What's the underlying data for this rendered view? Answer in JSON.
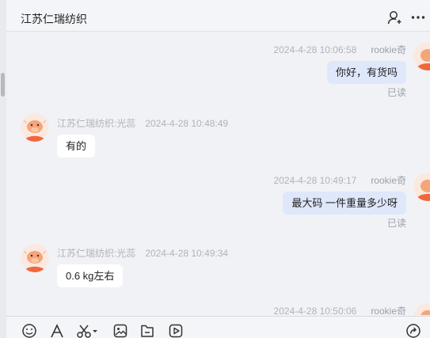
{
  "header": {
    "title": "江苏仁瑞纺织",
    "icons": [
      "add-contact-icon",
      "more-icon"
    ]
  },
  "messages": [
    {
      "direction": "out",
      "sender": "rookie奇",
      "time": "2024-4-28 10:06:58",
      "text": "你好，有货吗",
      "status": "已读"
    },
    {
      "direction": "in",
      "sender": "江苏仁瑞纺织:光蕊",
      "time": "2024-4-28 10:48:49",
      "text": "有的"
    },
    {
      "direction": "out",
      "sender": "rookie奇",
      "time": "2024-4-28 10:49:17",
      "text": "最大码 一件重量多少呀",
      "status": "已读"
    },
    {
      "direction": "in",
      "sender": "江苏仁瑞纺织:光蕊",
      "time": "2024-4-28 10:49:34",
      "text": "0.6 kg左右"
    },
    {
      "direction": "out",
      "sender": "rookie奇",
      "time": "2024-4-28 10:50:06",
      "text": ""
    }
  ],
  "toolbar": {
    "icons": [
      "emoji-icon",
      "font-icon",
      "screenshot-icon",
      "image-icon",
      "file-icon",
      "video-icon",
      "share-icon"
    ]
  },
  "colors": {
    "background": "#f1f2f6",
    "outgoing_bubble": "#dfe7fb",
    "incoming_bubble": "#ffffff",
    "avatar_accent": "#f0673d"
  }
}
